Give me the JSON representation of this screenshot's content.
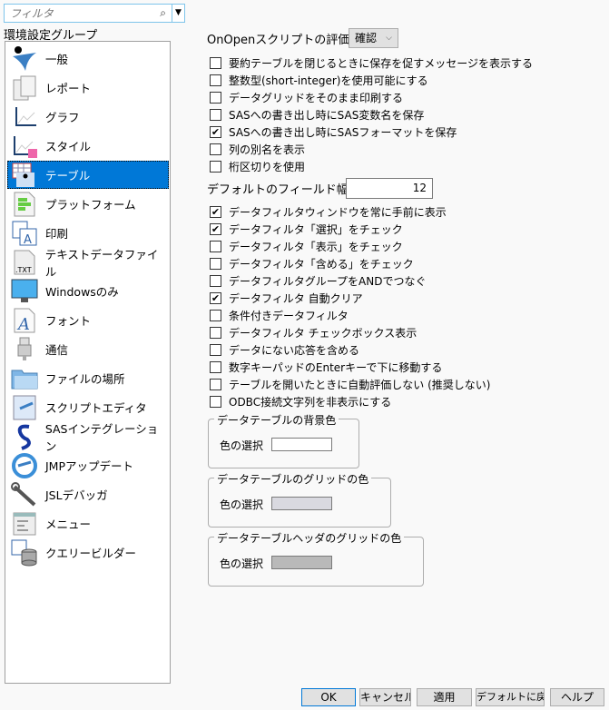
{
  "filter": {
    "placeholder": "フィルタ",
    "search_icon": "search-icon",
    "dropdown_icon": "chevron-down-icon"
  },
  "group_label": "環境設定グループ",
  "groups": [
    {
      "label": "一般",
      "icon": "jmp-person-icon"
    },
    {
      "label": "レポート",
      "icon": "report-pages-icon"
    },
    {
      "label": "グラフ",
      "icon": "line-graph-icon"
    },
    {
      "label": "スタイル",
      "icon": "graph-style-icon"
    },
    {
      "label": "テーブル",
      "icon": "data-table-icon",
      "selected": true
    },
    {
      "label": "プラットフォーム",
      "icon": "platform-icon"
    },
    {
      "label": "印刷",
      "icon": "print-icon"
    },
    {
      "label": "テキストデータファイル",
      "icon": "txt-file-icon"
    },
    {
      "label": "Windowsのみ",
      "icon": "monitor-icon"
    },
    {
      "label": "フォント",
      "icon": "font-icon"
    },
    {
      "label": "通信",
      "icon": "usb-icon"
    },
    {
      "label": "ファイルの場所",
      "icon": "folder-icon"
    },
    {
      "label": "スクリプトエディタ",
      "icon": "script-editor-icon"
    },
    {
      "label": "SASインテグレーション",
      "icon": "sas-icon"
    },
    {
      "label": "JMPアップデート",
      "icon": "update-icon"
    },
    {
      "label": "JSLデバッガ",
      "icon": "wrench-icon"
    },
    {
      "label": "メニュー",
      "icon": "menu-icon"
    },
    {
      "label": "クエリービルダー",
      "icon": "database-icon"
    }
  ],
  "onopen": {
    "label": "OnOpenスクリプトの評価",
    "value": "確認"
  },
  "options1": [
    {
      "label": "要約テーブルを閉じるときに保存を促すメッセージを表示する",
      "checked": false
    },
    {
      "label": "整数型(short-integer)を使用可能にする",
      "checked": false
    },
    {
      "label": "データグリッドをそのまま印刷する",
      "checked": false
    },
    {
      "label": "SASへの書き出し時にSAS変数名を保存",
      "checked": false
    },
    {
      "label": "SASへの書き出し時にSASフォーマットを保存",
      "checked": true
    },
    {
      "label": "列の別名を表示",
      "checked": false
    },
    {
      "label": "桁区切りを使用",
      "checked": false
    }
  ],
  "field_width": {
    "label": "デフォルトのフィールド幅",
    "value": "12"
  },
  "options2": [
    {
      "label": "データフィルタウィンドウを常に手前に表示",
      "checked": true
    },
    {
      "label": "データフィルタ「選択」をチェック",
      "checked": true
    },
    {
      "label": "データフィルタ「表示」をチェック",
      "checked": false
    },
    {
      "label": "データフィルタ「含める」をチェック",
      "checked": false
    },
    {
      "label": "データフィルタグループをANDでつなぐ",
      "checked": false
    },
    {
      "label": "データフィルタ 自動クリア",
      "checked": true
    },
    {
      "label": "条件付きデータフィルタ",
      "checked": false
    },
    {
      "label": "データフィルタ チェックボックス表示",
      "checked": false
    },
    {
      "label": "データにない応答を含める",
      "checked": false
    },
    {
      "label": "数字キーパッドのEnterキーで下に移動する",
      "checked": false
    },
    {
      "label": "テーブルを開いたときに自動評価しない (推奨しない)",
      "checked": false
    },
    {
      "label": "ODBC接続文字列を非表示にする",
      "checked": false
    }
  ],
  "color_groups": [
    {
      "title": "データテーブルの背景色",
      "select_label": "色の選択",
      "color": "#ffffff"
    },
    {
      "title": "データテーブルのグリッドの色",
      "select_label": "色の選択",
      "color": "#d9d9e0"
    },
    {
      "title": "データテーブルヘッダのグリッドの色",
      "select_label": "色の選択",
      "color": "#b9b9b9"
    }
  ],
  "buttons": {
    "ok": "OK",
    "cancel": "キャンセル",
    "apply": "適用",
    "reset": "デフォルトに戻す",
    "help": "ヘルプ"
  },
  "colors": {
    "accent": "#0078d7",
    "focus_border": "#7ec4ea"
  }
}
